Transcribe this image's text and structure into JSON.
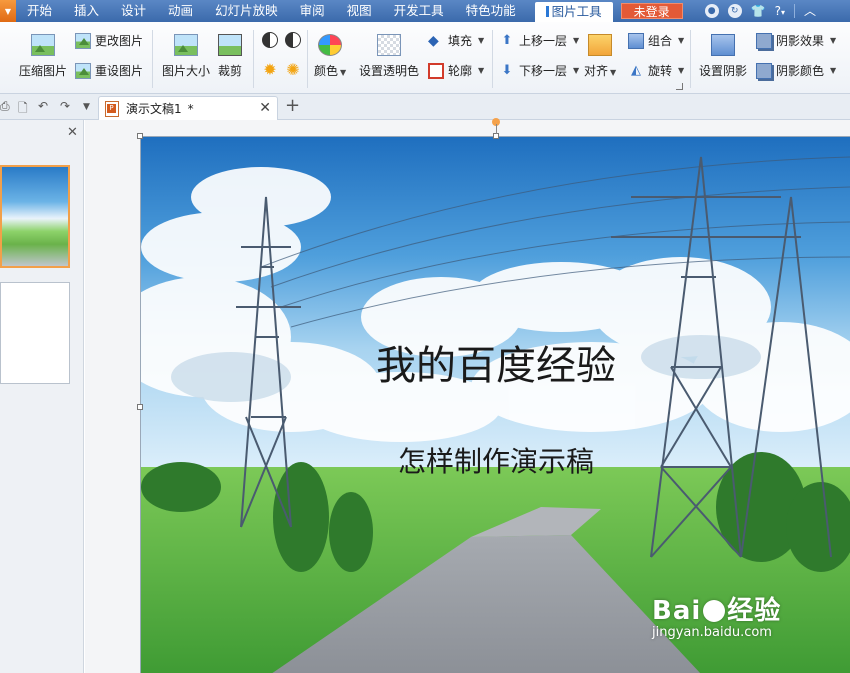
{
  "menubar": {
    "items": [
      "开始",
      "插入",
      "设计",
      "动画",
      "幻灯片放映",
      "审阅",
      "视图",
      "开发工具",
      "特色功能"
    ],
    "active_tab": "图片工具",
    "login": "未登录",
    "help": "?"
  },
  "ribbon": {
    "compress": "压缩图片",
    "change_image": "更改图片",
    "reset_image": "重设图片",
    "image_size": "图片大小",
    "crop": "裁剪",
    "color": "颜色",
    "set_transparent": "设置透明色",
    "fill": "填充",
    "outline": "轮廓",
    "bring_forward": "上移一层",
    "send_backward": "下移一层",
    "align": "对齐",
    "group": "组合",
    "rotate": "旋转",
    "set_shadow": "设置阴影",
    "shadow_effect": "阴影效果",
    "shadow_color": "阴影颜色"
  },
  "tabs": {
    "document_title": "演示文稿1",
    "modified_marker": "*"
  },
  "slide": {
    "title": "我的百度经验",
    "subtitle": "怎样制作演示稿"
  },
  "watermark": {
    "logo_left": "Bai",
    "logo_right": "经验",
    "url": "jingyan.baidu.com"
  },
  "colors": {
    "menubar": "#3b6aab",
    "login_button": "#e35a37",
    "thumbnail_selected": "#f2a04a"
  }
}
